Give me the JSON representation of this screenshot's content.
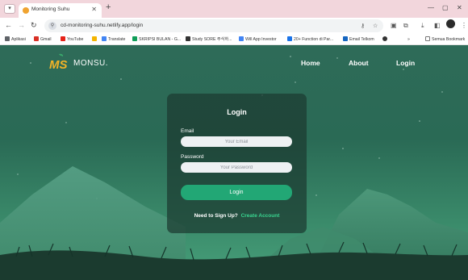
{
  "browser": {
    "tab_title": "Monitoring Suhu",
    "url": "cd-monitoring-suhu.netlify.app/login",
    "bookmarks": [
      "Aplikasi",
      "Gmail",
      "YouTube",
      "Translate",
      "SKRIPSI BULAN - G...",
      "Study SORE 주식하...",
      "Will App Investor",
      "20+ Function di Par...",
      "Email Telkom"
    ],
    "all_bookmarks": "Semua Bookmark"
  },
  "site": {
    "logo_text": "MS",
    "brand": "MONSU.",
    "nav": [
      "Home",
      "About",
      "Login"
    ]
  },
  "login": {
    "title": "Login",
    "email_label": "Email",
    "email_placeholder": "Your Email",
    "password_label": "Password",
    "password_placeholder": "Your Password",
    "button": "Login",
    "signup_prompt": "Need to Sign Up?",
    "signup_link": "Create Account"
  },
  "colors": {
    "accent": "#22a775",
    "link": "#39d48f",
    "page_bg": "#2e6b58"
  }
}
